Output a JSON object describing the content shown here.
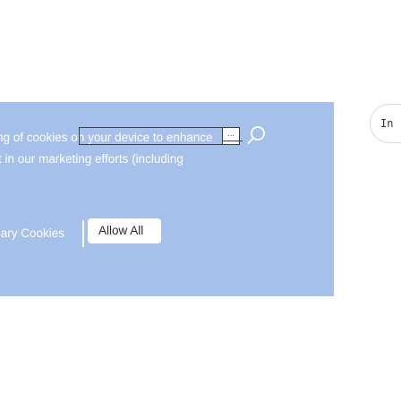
{
  "cookie_banner": {
    "text_line_1": "ng of cookies on your device to enhance",
    "text_line_2": "t in our marketing efforts (including",
    "ellipsis": "...",
    "necessary_cookies_button": "sary Cookies",
    "allow_all_button": "Allow All"
  },
  "side_button": {
    "label": "In"
  },
  "colors": {
    "banner_background": "#a6c0ec",
    "banner_text": "#ffffff",
    "button_background": "#ffffff",
    "button_text": "#2b2b2b"
  },
  "icons": {
    "search": "search-icon"
  }
}
